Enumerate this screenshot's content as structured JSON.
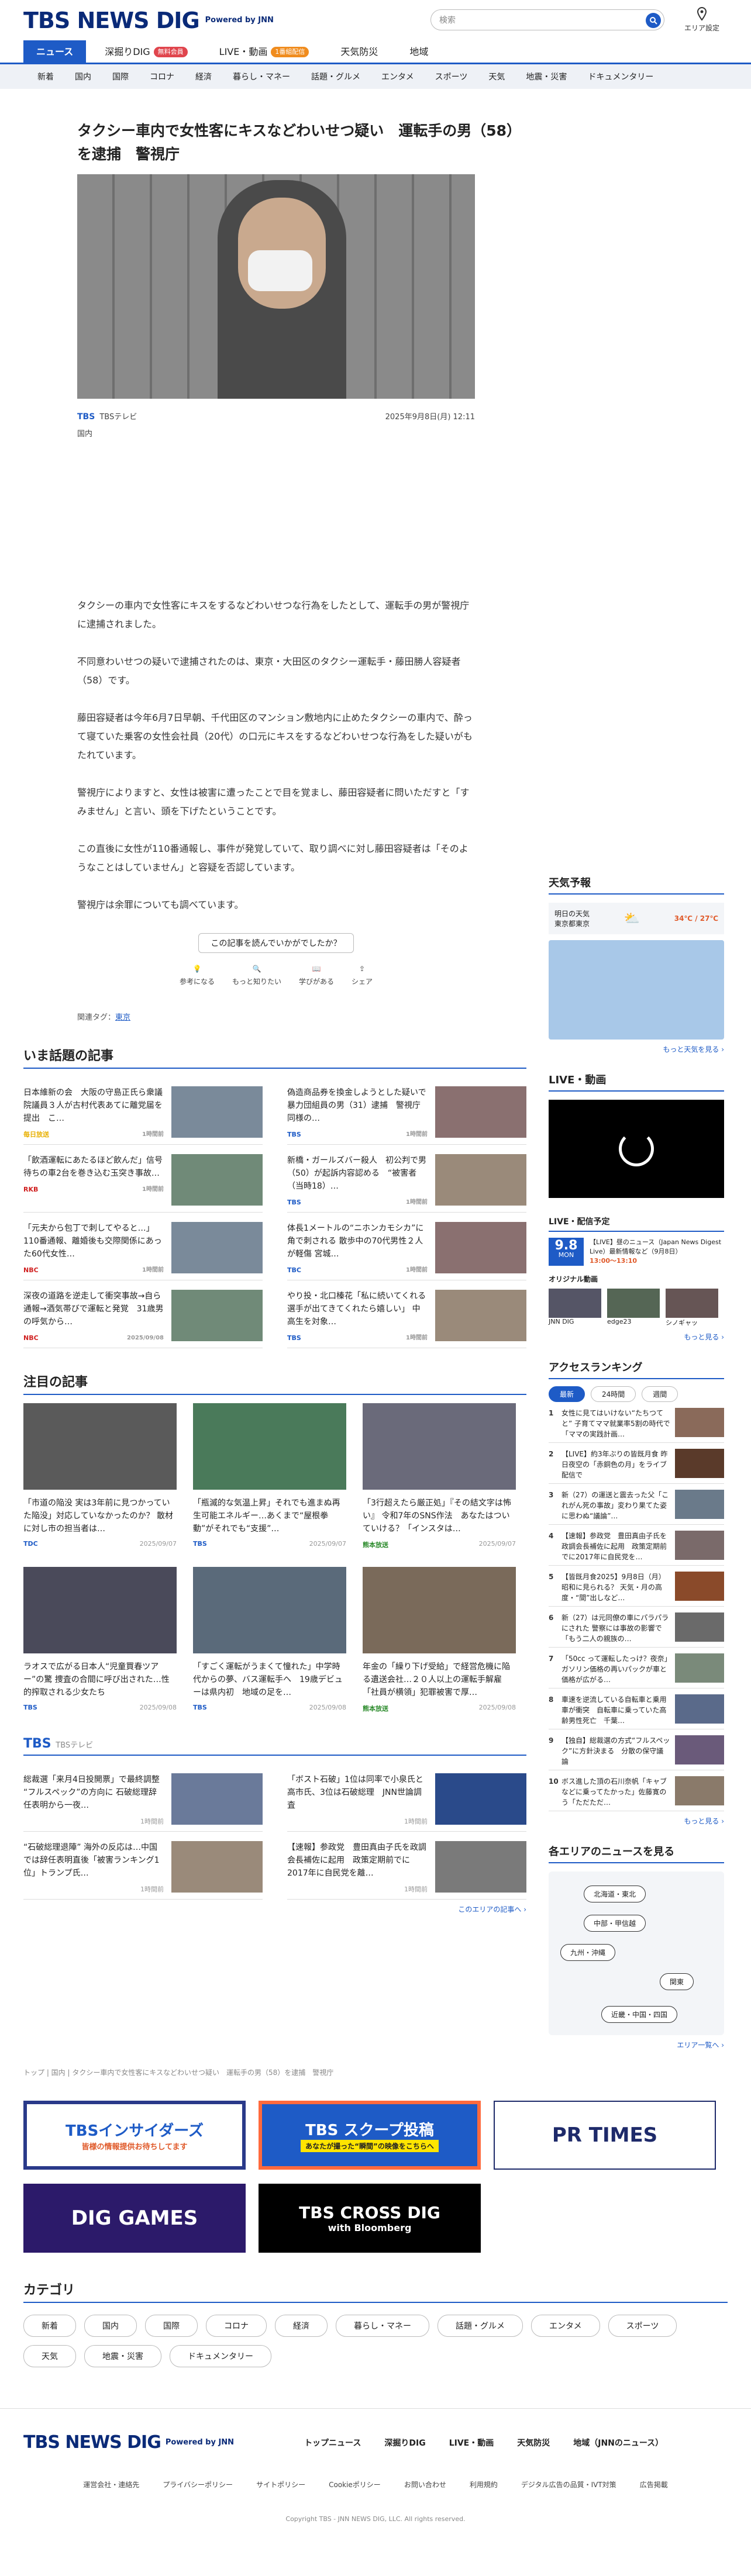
{
  "header": {
    "logo": "TBS NEWS DIG",
    "powered": "Powered by JNN",
    "search_placeholder": "検索",
    "area_setting": "エリア設定"
  },
  "nav": [
    {
      "label": "ニュース",
      "badge": ""
    },
    {
      "label": "深掘りDIG",
      "badge": "無料会員"
    },
    {
      "label": "LIVE・動画",
      "badge": "1番組配信"
    },
    {
      "label": "天気防災",
      "badge": ""
    },
    {
      "label": "地域",
      "badge": ""
    }
  ],
  "categories": [
    "新着",
    "国内",
    "国際",
    "経済",
    "コロナ",
    "経済",
    "暮らし・マネー",
    "話題・グルメ",
    "エンタメ",
    "スポーツ",
    "天気",
    "地震・災害",
    "ドキュメンタリー"
  ],
  "article": {
    "title": "タクシー車内で女性客にキスなどわいせつ疑い　運転手の男（58）を逮捕　警視庁",
    "source": "TBSテレビ",
    "date": "2025年9月8日(月) 12:11",
    "category": "国内",
    "paragraphs": [
      "タクシーの車内で女性客にキスをするなどわいせつな行為をしたとして、運転手の男が警視庁に逮捕されました。",
      "不同意わいせつの疑いで逮捕されたのは、東京・大田区のタクシー運転手・藤田勝人容疑者（58）です。",
      "藤田容疑者は今年6月7日早朝、千代田区のマンション敷地内に止めたタクシーの車内で、酔って寝ていた乗客の女性会社員（20代）の口元にキスをするなどわいせつな行為をした疑いがもたれています。",
      "警視庁によりますと、女性は被害に遭ったことで目を覚まし、藤田容疑者に問いただすと「すみません」と言い、頭を下げたということです。",
      "この直後に女性が110番通報し、事件が発覚していて、取り調べに対し藤田容疑者は「そのようなことはしていません」と容疑を否認しています。",
      "警視庁は余罪についても調べています。"
    ],
    "feedback_q": "この記事を読んでいかがでしたか？",
    "feedback_opts": [
      "参考になる",
      "もっと知りたい",
      "学びがある",
      "シェア"
    ],
    "tags_label": "関連タグ：",
    "tag": "東京"
  },
  "trending": {
    "title": "いま話題の記事",
    "items": [
      {
        "text": "日本維新の会　大阪の守島正氏ら衆議院議員３人が古村代表あてに離党届を提出　こ…",
        "src": "毎日放送",
        "date": "1時間前",
        "c": "#e8b000"
      },
      {
        "text": "偽造商品券を換金しようとした疑いで暴力団組員の男（31）逮捕　警視庁　同様の…",
        "src": "TBS",
        "date": "1時間前",
        "c": "#1e5bc6"
      },
      {
        "text": "「飲酒運転にあたるほど飲んだ」信号待ちの車2台を巻き込む玉突き事故…",
        "src": "RKB",
        "date": "1時間前",
        "c": "#d02020"
      },
      {
        "text": "新橋・ガールズバー殺人　初公判で男（50）が起訴内容認める　“被害者（当時18）…",
        "src": "TBS",
        "date": "1時間前",
        "c": "#1e5bc6"
      },
      {
        "text": "「元夫から包丁で刺してやると…」110番通報、離婚後も交際関係にあった60代女性…",
        "src": "NBC",
        "date": "1時間前",
        "c": "#d02020"
      },
      {
        "text": "体長1メートルの“ニホンカモシカ”に角で刺される 散歩中の70代男性２人が軽傷 宮城…",
        "src": "TBC",
        "date": "1時間前",
        "c": "#1e5bc6"
      },
      {
        "text": "深夜の道路を逆走して衝突事故→自ら通報→酒気帯びで運転と発覚　31歳男の呼気から…",
        "src": "NBC",
        "date": "2025/09/08",
        "c": "#d02020"
      },
      {
        "text": "やり投・北口榛花「私に続いてくれる選手が出てきてくれたら嬉しい」 中高生を対象…",
        "src": "TBS",
        "date": "1時間前",
        "c": "#1e5bc6"
      }
    ]
  },
  "featured": {
    "title": "注目の記事",
    "items": [
      {
        "text": "「市道の陥没 実は3年前に見つかっていた陥没」対応していなかったのか？ 散材に対し市の担当者は…",
        "src": "TDC",
        "date": "2025/09/07",
        "c": "#1e5bc6"
      },
      {
        "text": "「瓶滅的な気温上昇」それでも進まぬ再生可能エネルギー…あくまで“屋根拳動”がそれでも“支援”…",
        "src": "TBS",
        "date": "2025/09/07",
        "c": "#1e5bc6"
      },
      {
        "text": "「3行超えたら厳正処」『その結文字は怖い』 令和7年のSNS作法　あなたはついていける？「インスタは…",
        "src": "熊本放送",
        "date": "2025/09/07",
        "c": "#2a8a2a"
      },
      {
        "text": "ラオスで広がる日本人“児童買春ツアー”の驚 捜査の合間に呼び出された…性的搾取される少女たち",
        "src": "TBS",
        "date": "2025/09/08",
        "c": "#1e5bc6"
      },
      {
        "text": "「すごく運転がうまくて憧れた」中学時代からの夢、バス運転手へ　19歳デビューは県内初　地域の足を…",
        "src": "TBS",
        "date": "2025/09/08",
        "c": "#1e5bc6"
      },
      {
        "text": "年金の「繰り下げ受給」で経営危機に陥る遺送会社…２０人以上の運転手解雇「社員が横領」犯罪被害で厚…",
        "src": "熊本放送",
        "date": "2025/09/08",
        "c": "#2a8a2a"
      }
    ]
  },
  "tbs": {
    "title": "TBS",
    "sub": "TBSテレビ",
    "more": "このエリアの記事へ ›",
    "items": [
      {
        "text": "総裁選「来月4日投開票」で最終調整 “フルスペック”の方向に 石破総理辞任表明から一夜…",
        "date": "1時間前"
      },
      {
        "text": "「ボスト石破」1位は同率で小泉氏と高市氏、3位は石破総理　JNN世論調査",
        "date": "1時間前"
      },
      {
        "text": "“石破総理退陣” 海外の反応は…中国では辞任表明直後「被害ランキング1位」トランプ氏…",
        "date": "1時間前"
      },
      {
        "text": "【速報】参政党　豊田真由子氏を政調会長補佐に起用　政策定期前でに2017年に自民党を離…",
        "date": "1時間前"
      }
    ]
  },
  "breadcrumb": "トップ | 国内 | タクシー車内で女性客にキスなどわいせつ疑い　運転手の男（58）を逮捕　警視庁",
  "banners": [
    {
      "label": "TBSインサイダーズ",
      "sub": "皆様の情報提供お待ちしてます"
    },
    {
      "label": "TBS スクープ投稿",
      "sub": "あなたが撮った“瞬間”の映像をこちらへ"
    },
    {
      "label": "PR TIMES",
      "sub": ""
    },
    {
      "label": "DIG GAMES",
      "sub": ""
    },
    {
      "label": "TBS CROSS DIG",
      "sub": "with Bloomberg"
    }
  ],
  "category_section": {
    "title": "カテゴリ",
    "items": [
      "新着",
      "国内",
      "国際",
      "コロナ",
      "経済",
      "暮らし・マネー",
      "話題・グルメ",
      "エンタメ",
      "スポーツ",
      "天気",
      "地震・災害",
      "ドキュメンタリー"
    ]
  },
  "side": {
    "weather_title": "天気予報",
    "weather_loc": "明日の天気",
    "weather_city": "東京都東京",
    "weather_temp": "34℃ / 27℃",
    "weather_more": "もっと天気を見る ›",
    "live_title": "LIVE・動画",
    "live_sched_title": "LIVE・配信予定",
    "live_date": "9.8",
    "live_day": "MON",
    "live_prog": "【LIVE】昼のニュース（Japan News Digest Live）最新情報など（9月8日）",
    "live_time": "13:00〜13:10",
    "original_title": "オリジナル動画",
    "originals": [
      "JNN DIG",
      "edge23",
      "シノギャッ"
    ],
    "live_more": "もっと見る ›",
    "ranking_title": "アクセスランキング",
    "ranking_tabs": [
      "最新",
      "24時間",
      "週間"
    ],
    "ranking": [
      {
        "n": "1",
        "t": "女性に見てはいけない“たちつてと” 子育てママ就業率5割の時代で「ママの実践計画…"
      },
      {
        "n": "2",
        "t": "【LIVE】約3年ぶりの皆既月食 昨日夜空の「赤銅色の月」をライブ配信で"
      },
      {
        "n": "3",
        "t": "新（27）の運送と震去った父「これがん死の事故」変わり果てた姿に思わぬ“議論”…"
      },
      {
        "n": "4",
        "t": "【速報】参政党　豊田真由子氏を政調会長補佐に起用　政策定期前でに2017年に自民党を…"
      },
      {
        "n": "5",
        "t": "【皆既月食2025】9月8日（月）昭和に見られる？ 天気・月の高度・“間”出しなど…"
      },
      {
        "n": "6",
        "t": "新（27）は元同僚の車にパラパラにされた 警察には事故の影響で「もう二人の親族の…"
      },
      {
        "n": "7",
        "t": "「50cc って運転したっけ？夜奈」ガソリン価格の再いパックが車と価格が広がる…"
      },
      {
        "n": "8",
        "t": "車速を逆流している自転車と乗用車が衝突　自転車に乗っていた高齢男性死亡　千葉…"
      },
      {
        "n": "9",
        "t": "【独自】総裁選の方式“フルスペック”に方針決まる　分散の保守議論"
      },
      {
        "n": "10",
        "t": "ボス進した頂の石川奈帆「キャブなどに乗ってたかった」佐藤寛のう「ただただ…"
      }
    ],
    "ranking_more": "もっと見る ›",
    "areas_title": "各エリアのニュースを見る",
    "areas": [
      "北海道・東北",
      "中部・甲信越",
      "九州・沖縄",
      "関東",
      "近畿・中国・四国"
    ],
    "areas_more": "エリア一覧へ ›"
  },
  "footer": {
    "links": [
      "トップニュース",
      "深掘りDIG",
      "LIVE・動画",
      "天気防災",
      "地域（JNNのニュース）"
    ],
    "sub": [
      "運営会社・連絡先",
      "プライバシーポリシー",
      "サイトポリシー",
      "Cookieポリシー",
      "お問い合わせ",
      "利用規約",
      "デジタル広告の品質・IVT対策",
      "広告掲載"
    ],
    "copyright": "Copyright TBS - JNN NEWS DIG, LLC. All rights reserved."
  }
}
